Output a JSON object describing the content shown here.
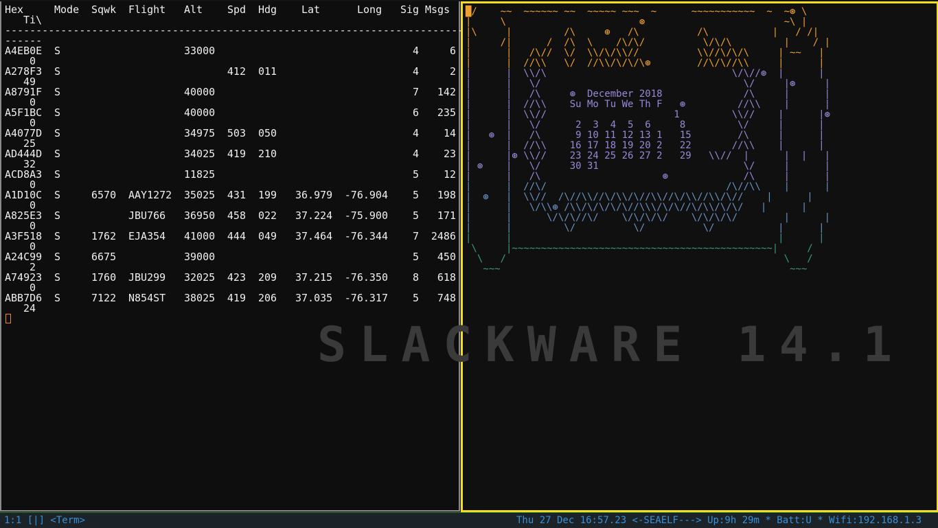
{
  "wallpaper": {
    "text": "SLACKWARE 14.1"
  },
  "dump1090": {
    "headers": {
      "hex": "Hex",
      "mode": "Mode",
      "sqwk": "Sqwk",
      "flight": "Flight",
      "alt": "Alt",
      "spd": "Spd",
      "hdg": "Hdg",
      "lat": "Lat",
      "long": "Long",
      "sig": "Sig",
      "msgs": "Msgs",
      "ti": "Ti\\"
    },
    "divider": "--------------------------------------------------------------------------",
    "divider2": "------",
    "rows": [
      {
        "hex": "A4EB0E",
        "mode": "S",
        "sqwk": "",
        "flight": "",
        "alt": "33000",
        "spd": "",
        "hdg": "",
        "lat": "",
        "long": "",
        "sig": "4",
        "msgs": "6",
        "ti": "0"
      },
      {
        "hex": "A278F3",
        "mode": "S",
        "sqwk": "",
        "flight": "",
        "alt": "",
        "spd": "412",
        "hdg": "011",
        "lat": "",
        "long": "",
        "sig": "4",
        "msgs": "2",
        "ti": "49"
      },
      {
        "hex": "A8791F",
        "mode": "S",
        "sqwk": "",
        "flight": "",
        "alt": "40000",
        "spd": "",
        "hdg": "",
        "lat": "",
        "long": "",
        "sig": "7",
        "msgs": "142",
        "ti": "0"
      },
      {
        "hex": "A5F1BC",
        "mode": "S",
        "sqwk": "",
        "flight": "",
        "alt": "40000",
        "spd": "",
        "hdg": "",
        "lat": "",
        "long": "",
        "sig": "6",
        "msgs": "235",
        "ti": "0"
      },
      {
        "hex": "A4077D",
        "mode": "S",
        "sqwk": "",
        "flight": "",
        "alt": "34975",
        "spd": "503",
        "hdg": "050",
        "lat": "",
        "long": "",
        "sig": "4",
        "msgs": "14",
        "ti": "25"
      },
      {
        "hex": "AD444D",
        "mode": "S",
        "sqwk": "",
        "flight": "",
        "alt": "34025",
        "spd": "419",
        "hdg": "210",
        "lat": "",
        "long": "",
        "sig": "4",
        "msgs": "23",
        "ti": "32"
      },
      {
        "hex": "ACD8A3",
        "mode": "S",
        "sqwk": "",
        "flight": "",
        "alt": "11825",
        "spd": "",
        "hdg": "",
        "lat": "",
        "long": "",
        "sig": "5",
        "msgs": "12",
        "ti": "0"
      },
      {
        "hex": "A1D10C",
        "mode": "S",
        "sqwk": "6570",
        "flight": "AAY1272",
        "alt": "35025",
        "spd": "431",
        "hdg": "199",
        "lat": "36.979",
        "long": "-76.904",
        "sig": "5",
        "msgs": "198",
        "ti": "0"
      },
      {
        "hex": "A825E3",
        "mode": "S",
        "sqwk": "",
        "flight": "JBU766",
        "alt": "36950",
        "spd": "458",
        "hdg": "022",
        "lat": "37.224",
        "long": "-75.900",
        "sig": "5",
        "msgs": "171",
        "ti": "0"
      },
      {
        "hex": "A3F518",
        "mode": "S",
        "sqwk": "1762",
        "flight": "EJA354",
        "alt": "41000",
        "spd": "444",
        "hdg": "049",
        "lat": "37.464",
        "long": "-76.344",
        "sig": "7",
        "msgs": "2486",
        "ti": "0"
      },
      {
        "hex": "A24C99",
        "mode": "S",
        "sqwk": "6675",
        "flight": "",
        "alt": "39000",
        "spd": "",
        "hdg": "",
        "lat": "",
        "long": "",
        "sig": "5",
        "msgs": "450",
        "ti": "2"
      },
      {
        "hex": "A74923",
        "mode": "S",
        "sqwk": "1760",
        "flight": "JBU299",
        "alt": "32025",
        "spd": "423",
        "hdg": "209",
        "lat": "37.215",
        "long": "-76.350",
        "sig": "8",
        "msgs": "618",
        "ti": "0"
      },
      {
        "hex": "ABB7D6",
        "mode": "S",
        "sqwk": "7122",
        "flight": "N854ST",
        "alt": "38025",
        "spd": "419",
        "hdg": "206",
        "lat": "37.035",
        "long": "-76.317",
        "sig": "5",
        "msgs": "748",
        "ti": "24"
      }
    ]
  },
  "calendar_art": {
    "lines": [
      "█/    ~~  ~~~~~~ ~~  ~~~~~ ~~~  ~      ~~~~~~~~~~~  ~  ~⊛ \\",
      "|     \\                       ⊛                        ~\\ |",
      "|\\     |         /\\     ⊛   /\\          /\\           |   / /|",
      "|     /|      /  /\\  \\    /\\/\\/          \\/\\/\\         |    / |",
      "|      |   /\\//  \\/  \\\\/\\/\\\\//          \\\\//\\/\\/\\     | ~~   |",
      "|      |  //\\\\   \\/  //\\\\/\\/\\/\\⊛        //\\/\\//\\\\     |      |",
      "|      |  \\\\/\\                                \\/\\//⊛  |      |",
      "|      |   \\/                                   \\/     |⊛     |",
      "|      |   /\\     ⊛  December 2018              /\\     |      |",
      "|      |  //\\\\    Su Mo Tu We Th F   ⊛         //\\\\    |      |",
      "|      |  \\\\//                      1         \\\\//    |      |⊛",
      "|      |   \\/      2  3  4  5  6     8         \\/     |      |",
      "|   ⊛  |   /\\      9 10 11 12 13 1   15        /\\     |      |",
      "|      |  //\\\\    16 17 18 19 20 2   22       //\\\\    |      |",
      "|      |⊛ \\\\//    23 24 25 26 27 2   29   \\\\//  |      |  |   |",
      "| ⊛    |   \\/     30 31                         \\/     |      |",
      "|      |   /\\                     ⊛             /\\     |      |",
      "|      |  //\\/                               /\\//\\\\    |      |",
      "|  ⊛   |  \\\\//  /\\//\\\\//\\/\\\\/\\//\\\\//\\/\\\\//\\\\/\\//    |      |",
      "|      |   \\/\\\\⊛ /\\\\/\\/\\/\\/\\//\\\\\\/\\/\\//\\/\\\\/\\/\\/   |      |",
      "|      |      \\/\\/\\//\\/    \\/\\/\\/\\/    \\/\\/\\/\\/        |      |",
      "|      |         \\/          \\/          \\/           |      |",
      "|      |                                              |      |",
      " \\     |~~~~~~~~~~~~~~~~~~~~~~~~~~~~~~~~~~~~~~~~~~~~~|     /",
      "  \\   /                                                \\   /",
      "   ~~~                                                  ~~~"
    ],
    "palette": {
      "orange": "#f0a030",
      "red": "#e04848",
      "purple": "#6c5aa8",
      "blue": "#6a92c4",
      "teal": "#3e9882",
      "snow": "#ffffff"
    }
  },
  "statusbar": {
    "left": "1:1 [|] <Term>",
    "right": "Thu 27 Dec 16:57.23  <-SEAELF---> Up:9h 29m * Batt:U * Wifi:192.168.1.3"
  }
}
